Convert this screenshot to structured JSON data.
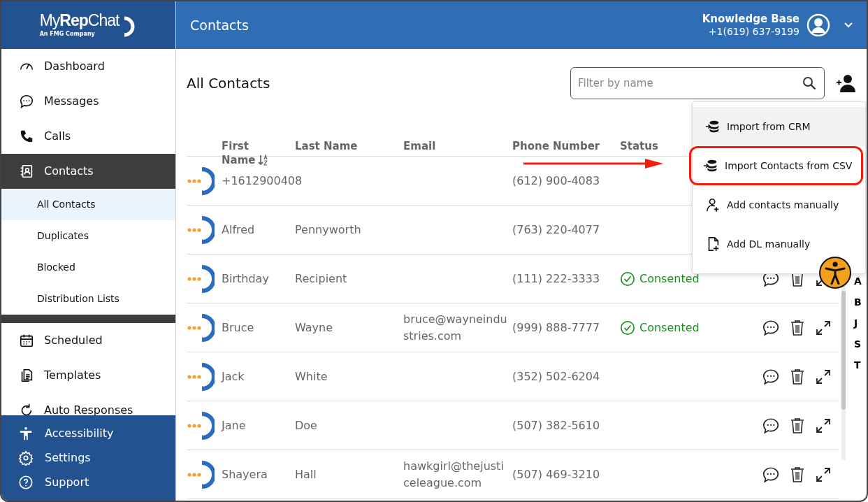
{
  "sidebar": {
    "logo": {
      "brand_light_1": "My",
      "brand_bold": "Rep",
      "brand_light_2": "Chat",
      "tagline": "An FMG Company"
    },
    "items": [
      {
        "label": "Dashboard",
        "selected": false
      },
      {
        "label": "Messages",
        "selected": false
      },
      {
        "label": "Calls",
        "selected": false
      },
      {
        "label": "Contacts",
        "selected": true,
        "children": [
          {
            "label": "All Contacts",
            "selected": true
          },
          {
            "label": "Duplicates",
            "selected": false
          },
          {
            "label": "Blocked",
            "selected": false
          },
          {
            "label": "Distribution Lists",
            "selected": false
          }
        ]
      },
      {
        "label": "Scheduled",
        "selected": false
      },
      {
        "label": "Templates",
        "selected": false
      },
      {
        "label": "Auto Responses",
        "selected": false
      }
    ],
    "footer_items": [
      {
        "label": "Accessibility"
      },
      {
        "label": "Settings"
      },
      {
        "label": "Support"
      }
    ]
  },
  "header": {
    "title": "Contacts",
    "user_name": "Knowledge Base",
    "user_phone": "+1(619) 637-9199"
  },
  "page": {
    "title": "All Contacts",
    "search": {
      "placeholder": "Filter by name"
    }
  },
  "menu": {
    "items": [
      {
        "label": "Import from CRM",
        "selected": true,
        "annotated": false
      },
      {
        "label": "Import Contacts from CSV",
        "selected": false,
        "annotated": true
      },
      {
        "label": "Add contacts manually",
        "selected": false,
        "annotated": false
      },
      {
        "label": "Add DL manually",
        "selected": false,
        "annotated": false
      }
    ]
  },
  "table": {
    "columns": [
      {
        "label": "First",
        "label_line_2": "Name"
      },
      {
        "label": "Last Name"
      },
      {
        "label": "Email"
      },
      {
        "label": "Phone Number"
      },
      {
        "label": "Status"
      }
    ],
    "rows": [
      {
        "first": "+1612900408",
        "phone": "(612) 900-4083",
        "actions_visible": false
      },
      {
        "first": "Alfred",
        "last": "Pennyworth",
        "phone": "(763) 220-4077",
        "actions_visible": false
      },
      {
        "first": "Birthday",
        "last": "Recipient",
        "phone": "(111) 222-3333",
        "status": "Consented",
        "actions_visible": true
      },
      {
        "first": "Bruce",
        "last": "Wayne",
        "email": "bruce@wayneindustries.com",
        "phone": "(999) 888-7777",
        "status": "Consented",
        "actions_visible": true
      },
      {
        "first": "Jack",
        "last": "White",
        "phone": "(352) 502-6204",
        "actions_visible": true
      },
      {
        "first": "Jane",
        "last": "Doe",
        "phone": "(507) 382-5610",
        "actions_visible": true
      },
      {
        "first": "Shayera",
        "last": "Hall",
        "email": "hawkgirl@thejusticeleague.com",
        "phone": "(507) 469-3210",
        "actions_visible": true
      }
    ]
  },
  "alphabet": [
    "A",
    "B",
    "J",
    "S",
    "T"
  ]
}
